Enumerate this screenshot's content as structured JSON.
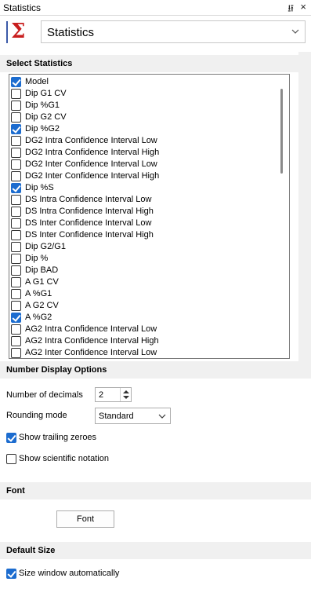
{
  "window": {
    "title": "Statistics",
    "pin_glyph": "⭿",
    "close_glyph": "×"
  },
  "header": {
    "icon": "sigma-icon",
    "view_select": {
      "value": "Statistics"
    }
  },
  "select_statistics": {
    "title": "Select Statistics",
    "items": [
      {
        "label": "Model",
        "checked": true
      },
      {
        "label": "Dip G1 CV",
        "checked": false
      },
      {
        "label": "Dip %G1",
        "checked": false
      },
      {
        "label": "Dip G2 CV",
        "checked": false
      },
      {
        "label": "Dip %G2",
        "checked": true
      },
      {
        "label": "DG2 Intra Confidence Interval Low",
        "checked": false
      },
      {
        "label": "DG2 Intra Confidence Interval High",
        "checked": false
      },
      {
        "label": "DG2 Inter Confidence Interval Low",
        "checked": false
      },
      {
        "label": "DG2 Inter Confidence Interval High",
        "checked": false
      },
      {
        "label": "Dip %S",
        "checked": true
      },
      {
        "label": "DS Intra Confidence Interval Low",
        "checked": false
      },
      {
        "label": "DS Intra Confidence Interval High",
        "checked": false
      },
      {
        "label": "DS Inter Confidence Interval Low",
        "checked": false
      },
      {
        "label": "DS Inter Confidence Interval High",
        "checked": false
      },
      {
        "label": "Dip G2/G1",
        "checked": false
      },
      {
        "label": "Dip %",
        "checked": false
      },
      {
        "label": "Dip BAD",
        "checked": false
      },
      {
        "label": "A G1 CV",
        "checked": false
      },
      {
        "label": "A %G1",
        "checked": false
      },
      {
        "label": "A G2 CV",
        "checked": false
      },
      {
        "label": "A %G2",
        "checked": true
      },
      {
        "label": "AG2 Intra Confidence Interval Low",
        "checked": false
      },
      {
        "label": "AG2 Intra Confidence Interval High",
        "checked": false
      },
      {
        "label": "AG2 Inter Confidence Interval Low",
        "checked": false
      }
    ]
  },
  "number_display": {
    "title": "Number Display Options",
    "decimals_label": "Number of decimals",
    "decimals_value": "2",
    "rounding_label": "Rounding mode",
    "rounding_value": "Standard",
    "show_trailing_zeroes": {
      "label": "Show trailing zeroes",
      "checked": true
    },
    "show_scientific": {
      "label": "Show scientific notation",
      "checked": false
    }
  },
  "font": {
    "title": "Font",
    "button_label": "Font"
  },
  "default_size": {
    "title": "Default Size",
    "size_auto": {
      "label": "Size window automatically",
      "checked": true
    }
  },
  "colors": {
    "checkbox_on": "#1c6ccf",
    "sigma": "#c81e1e",
    "section_bg": "#f0f0f0"
  }
}
